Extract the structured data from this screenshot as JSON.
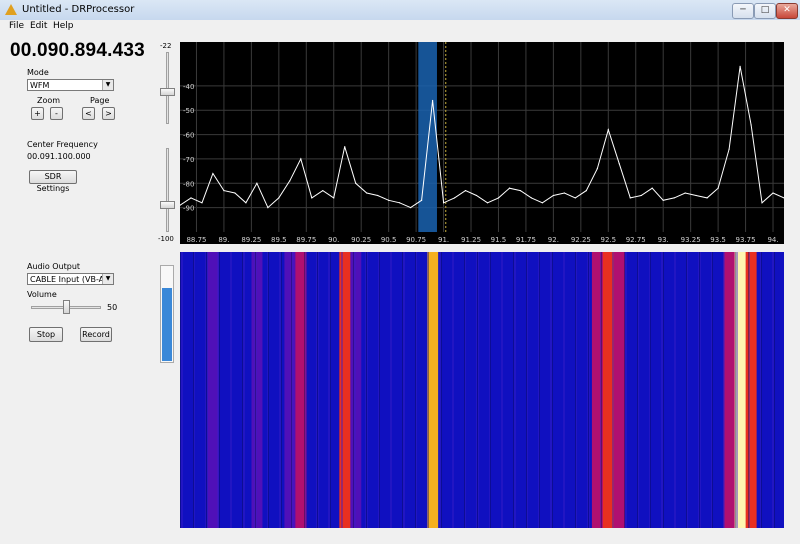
{
  "window": {
    "title": "Untitled - DRProcessor",
    "controls": {
      "minimize": "─",
      "maximize": "□",
      "close": "✕"
    }
  },
  "menu": [
    "File",
    "Edit",
    "Help"
  ],
  "frequency_display": "00.090.894.433",
  "mode": {
    "label": "Mode",
    "value": "WFM"
  },
  "zoom": {
    "label": "Zoom",
    "in": "+",
    "out": "-"
  },
  "page": {
    "label": "Page",
    "prev": "<",
    "next": ">"
  },
  "center_frequency": {
    "label": "Center Frequency",
    "value": "00.091.100.000"
  },
  "sdr_settings_label": "SDR Settings",
  "audio_output": {
    "label": "Audio Output",
    "value": "CABLE Input (VB-Audio"
  },
  "volume": {
    "label": "Volume",
    "value": "50",
    "level": 0.5
  },
  "stop_label": "Stop",
  "record_label": "Record",
  "gain_scale": {
    "top": "-22",
    "bottom": "-100"
  },
  "audio_meter_level": 0.78,
  "colors": {
    "spectrum_bg": "#000000",
    "trace": "#ffffff",
    "selection": "#1a63b0",
    "meter": "#3a88d8"
  },
  "chart_data": {
    "type": "line",
    "xlabel": "",
    "ylabel": "",
    "x_ticks": [
      "88.75",
      "89.",
      "89.25",
      "89.5",
      "89.75",
      "90.",
      "90.25",
      "90.5",
      "90.75",
      "91.",
      "91.25",
      "91.5",
      "91.75",
      "92.",
      "92.25",
      "92.5",
      "92.75",
      "93.",
      "93.25",
      "93.5",
      "93.75",
      "94."
    ],
    "y_ticks": [
      "-40",
      "-50",
      "-60",
      "-70",
      "-80",
      "-90"
    ],
    "xlim": [
      88.6,
      94.1
    ],
    "ylim": [
      -100,
      -22
    ],
    "x": [
      88.6,
      88.7,
      88.8,
      88.9,
      89.0,
      89.1,
      89.2,
      89.3,
      89.4,
      89.5,
      89.6,
      89.7,
      89.8,
      89.9,
      90.0,
      90.1,
      90.2,
      90.3,
      90.4,
      90.5,
      90.6,
      90.7,
      90.8,
      90.9,
      91.0,
      91.1,
      91.2,
      91.3,
      91.4,
      91.5,
      91.6,
      91.7,
      91.8,
      91.9,
      92.0,
      92.1,
      92.2,
      92.3,
      92.4,
      92.5,
      92.6,
      92.7,
      92.8,
      92.9,
      93.0,
      93.1,
      93.2,
      93.3,
      93.4,
      93.5,
      93.6,
      93.7,
      93.8,
      93.9,
      94.0,
      94.1
    ],
    "y": [
      -89,
      -86,
      -88,
      -76,
      -83,
      -84,
      -88,
      -80,
      -90,
      -86,
      -79,
      -70,
      -86,
      -83,
      -86,
      -65,
      -80,
      -84,
      -85,
      -87,
      -88,
      -90,
      -87,
      -46,
      -88,
      -86,
      -83,
      -85,
      -88,
      -86,
      -82,
      -83,
      -86,
      -88,
      -85,
      -84,
      -86,
      -83,
      -74,
      -58,
      -72,
      -86,
      -85,
      -82,
      -87,
      -86,
      -84,
      -85,
      -86,
      -82,
      -66,
      -32,
      -56,
      -88,
      -84,
      -86
    ],
    "selection": [
      90.77,
      90.94
    ],
    "marker": 91.02,
    "grid": true
  }
}
